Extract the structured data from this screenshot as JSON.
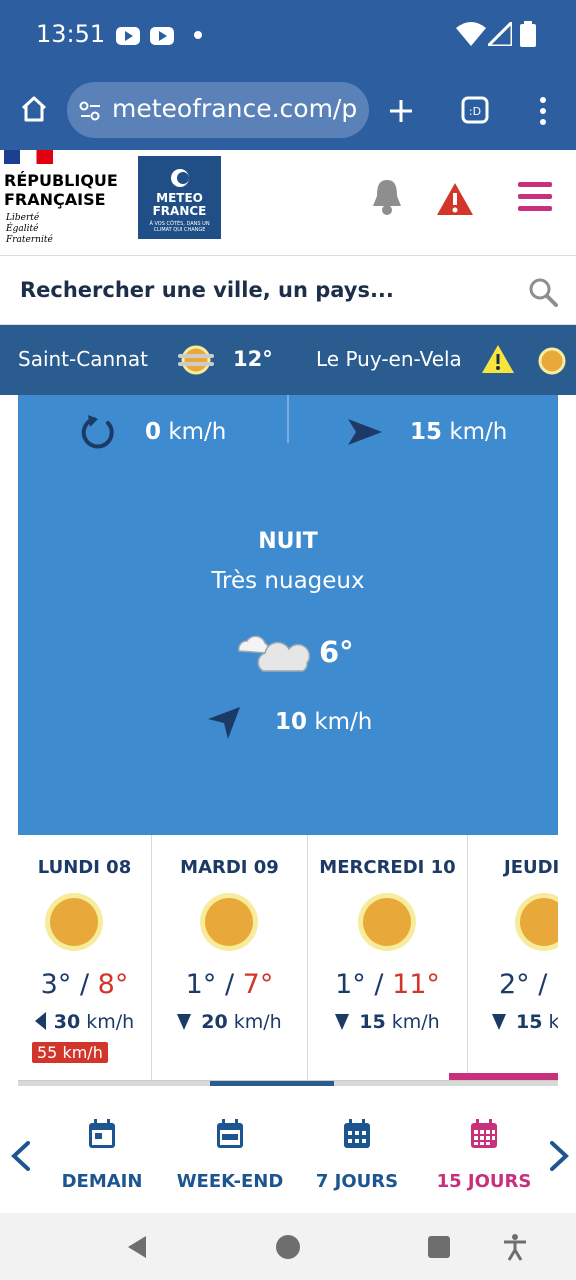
{
  "status_bar": {
    "time": "13:51"
  },
  "browser": {
    "url": "meteofrance.com/p"
  },
  "header": {
    "rf_line1": "RÉPUBLIQUE",
    "rf_line2": "FRANÇAISE",
    "rf_motto1": "Liberté",
    "rf_motto2": "Égalité",
    "rf_motto3": "Fraternité",
    "mf_line1": "METEO",
    "mf_line2": "FRANCE",
    "mf_tagline": "À VOS CÔTÉS, DANS UN CLIMAT QUI CHANGE"
  },
  "search": {
    "placeholder": "Rechercher une ville, un pays..."
  },
  "favorites": [
    {
      "city": "Saint-Cannat",
      "temp": "12°"
    },
    {
      "city": "Le Puy-en-Vela"
    }
  ],
  "panel": {
    "wind_left": {
      "value": "0",
      "unit": "km/h"
    },
    "wind_right": {
      "value": "15",
      "unit": "km/h"
    },
    "period": "NUIT",
    "condition": "Très nuageux",
    "temp": "6°",
    "wind": {
      "value": "10",
      "unit": "km/h"
    }
  },
  "days": [
    {
      "name": "LUNDI 08",
      "min": "3°",
      "max": "8°",
      "wind": "30",
      "unit": "km/h",
      "gust": "55 km/h"
    },
    {
      "name": "MARDI 09",
      "min": "1°",
      "max": "7°",
      "wind": "20",
      "unit": "km/h"
    },
    {
      "name": "MERCREDI 10",
      "min": "1°",
      "max": "11°",
      "wind": "15",
      "unit": "km/h"
    },
    {
      "name": "JEUDI",
      "min": "2°",
      "max": "",
      "wind": "15",
      "unit": "km/h"
    }
  ],
  "temp_separator": "/",
  "nav": {
    "items": [
      "DEMAIN",
      "WEEK-END",
      "7 JOURS",
      "15 JOURS"
    ],
    "active": "15 JOURS"
  },
  "colors": {
    "brand_blue": "#2d5fa0",
    "panel_blue": "#3f8bd0",
    "accent_pink": "#c8307c",
    "alert_red": "#d2362b"
  }
}
